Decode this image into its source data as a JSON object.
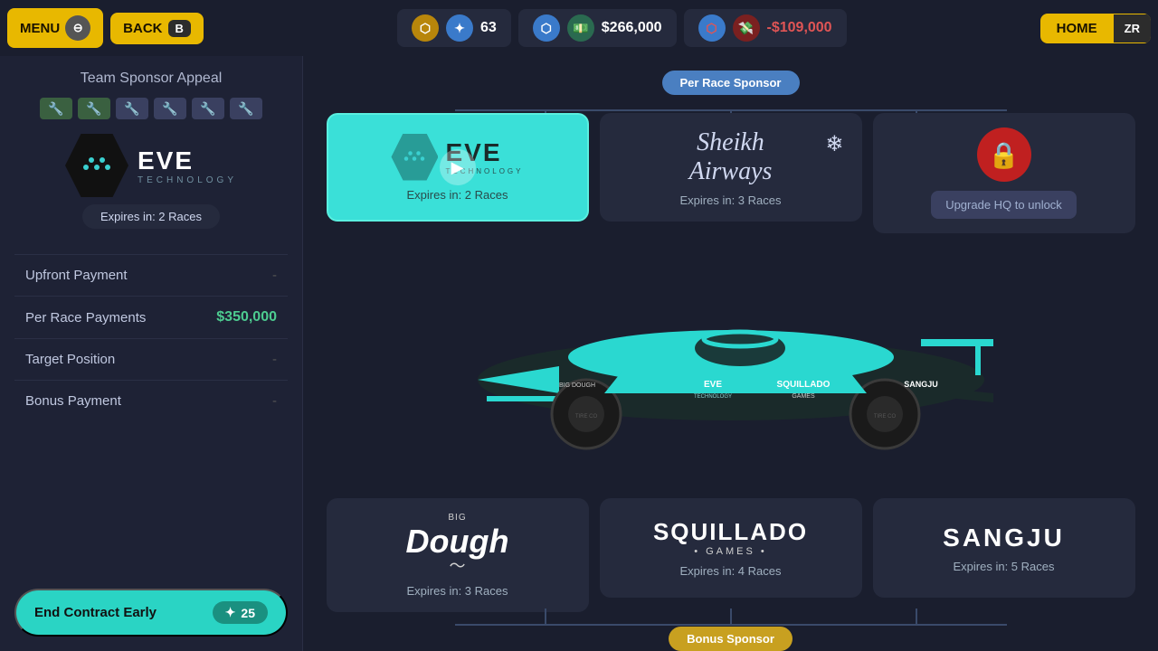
{
  "topBar": {
    "menu_label": "MENU",
    "menu_icon": "☰",
    "menu_badge": "⊖",
    "back_label": "BACK",
    "back_badge": "B",
    "prestige_icon": "⬡",
    "prestige_value": "63",
    "money_icon": "💵",
    "money_value": "$266,000",
    "debt_icon": "💸",
    "debt_value": "-$109,000",
    "home_label": "HOME",
    "home_badge": "ZR"
  },
  "leftPanel": {
    "title": "Team Sponsor Appeal",
    "sponsor_name": "EVE",
    "sponsor_sub": "TECHNOLOGY",
    "expires_label": "Expires in: 2 Races",
    "upfront_label": "Upfront Payment",
    "upfront_value": "-",
    "per_race_label": "Per Race Payments",
    "per_race_value": "$350,000",
    "target_label": "Target Position",
    "target_value": "-",
    "bonus_label": "Bonus Payment",
    "bonus_value": "-",
    "end_contract_label": "End Contract Early",
    "end_contract_cost": "25"
  },
  "sponsorCardsTop": {
    "section_label": "Per Race Sponsor",
    "cards": [
      {
        "id": "eve",
        "brand": "EVE",
        "brand_sub": "TECHNOLOGY",
        "expires": "Expires in: 2 Races",
        "active": true
      },
      {
        "id": "sheikh",
        "brand": "Sheikh Airways",
        "expires": "Expires in: 3 Races",
        "active": false
      },
      {
        "id": "locked",
        "brand": "Upgrade HQ to unlock",
        "active": false,
        "locked": true
      }
    ]
  },
  "sponsorCardsBottom": {
    "section_label": "Bonus Sponsor",
    "cards": [
      {
        "id": "bigdough",
        "brand": "BIG DOUGH",
        "expires": "Expires in: 3 Races"
      },
      {
        "id": "squillado",
        "brand": "SQUILLADO GAMES",
        "expires": "Expires in: 4 Races"
      },
      {
        "id": "sangju",
        "brand": "SANGJU",
        "expires": "Expires in: 5 Races"
      }
    ]
  }
}
